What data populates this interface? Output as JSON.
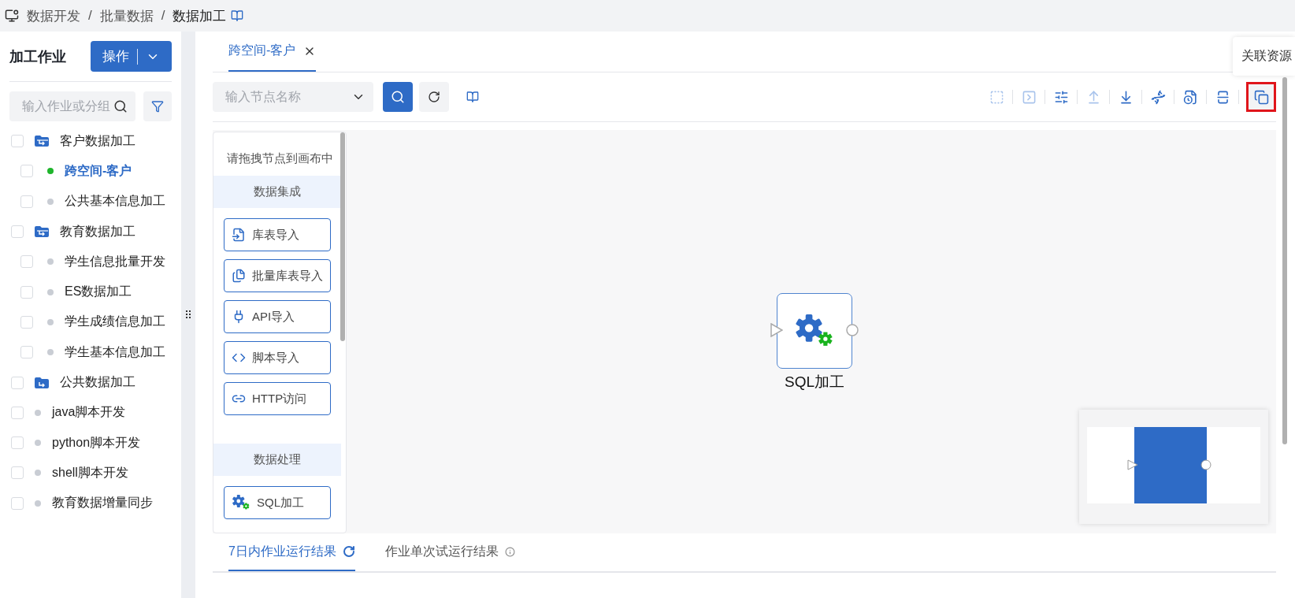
{
  "breadcrumb": {
    "items": [
      "数据开发",
      "批量数据",
      "数据加工"
    ],
    "separator": "/"
  },
  "sidebar": {
    "title": "加工作业",
    "action_button": "操作",
    "search": {
      "placeholder": "输入作业或分组"
    },
    "tree": [
      {
        "kind": "group",
        "label": "客户数据加工",
        "checked": false,
        "expanded": true,
        "children": [
          {
            "kind": "job",
            "label": "跨空间-客户",
            "checked": false,
            "selected": true,
            "color": "#1fb52c"
          },
          {
            "kind": "job",
            "label": "公共基本信息加工",
            "checked": false,
            "selected": false,
            "color": "#c9cdd4"
          }
        ]
      },
      {
        "kind": "group",
        "label": "教育数据加工",
        "checked": false,
        "expanded": true,
        "children": [
          {
            "kind": "job",
            "label": "学生信息批量开发",
            "checked": false,
            "selected": false,
            "color": "#c9cdd4"
          },
          {
            "kind": "job",
            "label": "ES数据加工",
            "checked": false,
            "selected": false,
            "color": "#c9cdd4"
          },
          {
            "kind": "job",
            "label": "学生成绩信息加工",
            "checked": false,
            "selected": false,
            "color": "#c9cdd4"
          },
          {
            "kind": "job",
            "label": "学生基本信息加工",
            "checked": false,
            "selected": false,
            "color": "#c9cdd4"
          }
        ]
      },
      {
        "kind": "group",
        "label": "公共数据加工",
        "checked": false,
        "expanded": false
      },
      {
        "kind": "job",
        "label": "java脚本开发",
        "checked": false,
        "selected": false,
        "color": "#c9cdd4"
      },
      {
        "kind": "job",
        "label": "python脚本开发",
        "checked": false,
        "selected": false,
        "color": "#c9cdd4"
      },
      {
        "kind": "job",
        "label": "shell脚本开发",
        "checked": false,
        "selected": false,
        "color": "#c9cdd4"
      },
      {
        "kind": "job",
        "label": "教育数据增量同步",
        "checked": false,
        "selected": false,
        "color": "#c9cdd4"
      }
    ]
  },
  "tabs": [
    {
      "label": "跨空间-客户",
      "selected": true
    }
  ],
  "toolbar": {
    "node_search": {
      "placeholder": "输入节点名称"
    },
    "actions": [
      {
        "kind": "run-selected",
        "disabled": true,
        "highlighted": false
      },
      {
        "kind": "run-all",
        "disabled": true,
        "highlighted": false
      },
      {
        "kind": "params",
        "disabled": false,
        "highlighted": false
      },
      {
        "kind": "upload",
        "disabled": true,
        "highlighted": false
      },
      {
        "kind": "download",
        "disabled": false,
        "highlighted": false
      },
      {
        "kind": "lineage",
        "disabled": false,
        "highlighted": false
      },
      {
        "kind": "schedule",
        "disabled": false,
        "highlighted": false
      },
      {
        "kind": "supplement",
        "disabled": false,
        "highlighted": false
      },
      {
        "kind": "resources",
        "disabled": false,
        "highlighted": true
      }
    ]
  },
  "tooltip": {
    "text": "关联资源"
  },
  "palette": {
    "hint": "请拖拽节点到画布中",
    "sections": [
      {
        "title": "数据集成",
        "items": [
          {
            "kind": "table-import",
            "label": "库表导入"
          },
          {
            "kind": "batch-import",
            "label": "批量库表导入"
          },
          {
            "kind": "api",
            "label": "API导入"
          },
          {
            "kind": "script",
            "label": "脚本导入"
          },
          {
            "kind": "http",
            "label": "HTTP访问"
          }
        ]
      },
      {
        "title": "数据处理",
        "items": [
          {
            "kind": "sql",
            "label": "SQL加工"
          }
        ]
      }
    ]
  },
  "canvas": {
    "nodes": [
      {
        "kind": "sql",
        "label": "SQL加工"
      }
    ]
  },
  "result_tabs": [
    {
      "label": "7日内作业运行结果",
      "selected": true,
      "kind": "refresh"
    },
    {
      "label": "作业单次试运行结果",
      "selected": false,
      "kind": "info"
    }
  ]
}
